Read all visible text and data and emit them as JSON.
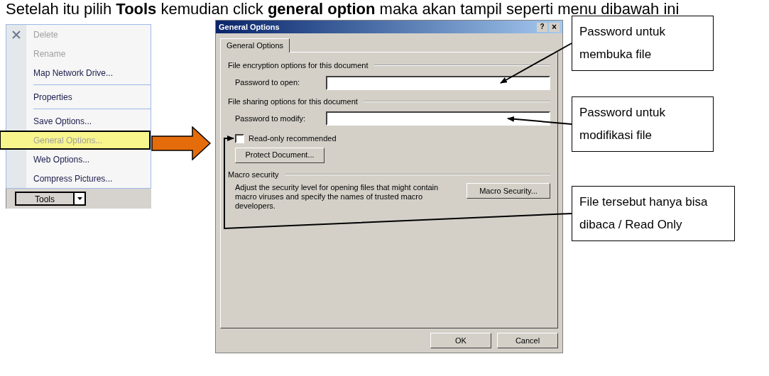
{
  "heading": "Setelah itu pilih **Tools** kemudian click **general option** maka akan tampil seperti menu dibawah ini",
  "menu": {
    "items": [
      {
        "kind": "item",
        "label": "Delete",
        "disabled": true,
        "highlighted": false
      },
      {
        "kind": "item",
        "label": "Rename",
        "disabled": true,
        "highlighted": false
      },
      {
        "kind": "item",
        "label": "Map Network Drive...",
        "disabled": false,
        "highlighted": false
      },
      {
        "kind": "separator"
      },
      {
        "kind": "item",
        "label": "Properties",
        "disabled": false,
        "highlighted": false
      },
      {
        "kind": "separator"
      },
      {
        "kind": "item",
        "label": "Save Options...",
        "disabled": false,
        "highlighted": false
      },
      {
        "kind": "item",
        "label": "General Options...",
        "disabled": true,
        "highlighted": true
      },
      {
        "kind": "item",
        "label": "Web Options...",
        "disabled": false,
        "highlighted": false
      },
      {
        "kind": "item",
        "label": "Compress Pictures...",
        "disabled": false,
        "highlighted": false
      }
    ],
    "button": "Tools"
  },
  "dialog": {
    "title": "General Options",
    "help": "?",
    "close": "×",
    "tabs": [
      {
        "label": "General Options",
        "selected": true
      }
    ],
    "encryption_group": "File encryption options for this document",
    "password_open_label": "Password to open:",
    "sharing_group": "File sharing options for this document",
    "password_modify_label": "Password to modify:",
    "read_only": {
      "label": "Read-only recommended",
      "checked": false
    },
    "protect_button": "Protect Document...",
    "macro_group": "Macro security",
    "macro_text": "Adjust the security level for opening files that might contain macro viruses and specify the names of trusted macro developers.",
    "macro_button": "Macro Security...",
    "buttons": [
      "OK",
      "Cancel"
    ]
  },
  "callouts": [
    "Password untuk membuka file",
    "Password untuk modifikasi file",
    "File tersebut hanya bisa dibaca / Read Only"
  ]
}
